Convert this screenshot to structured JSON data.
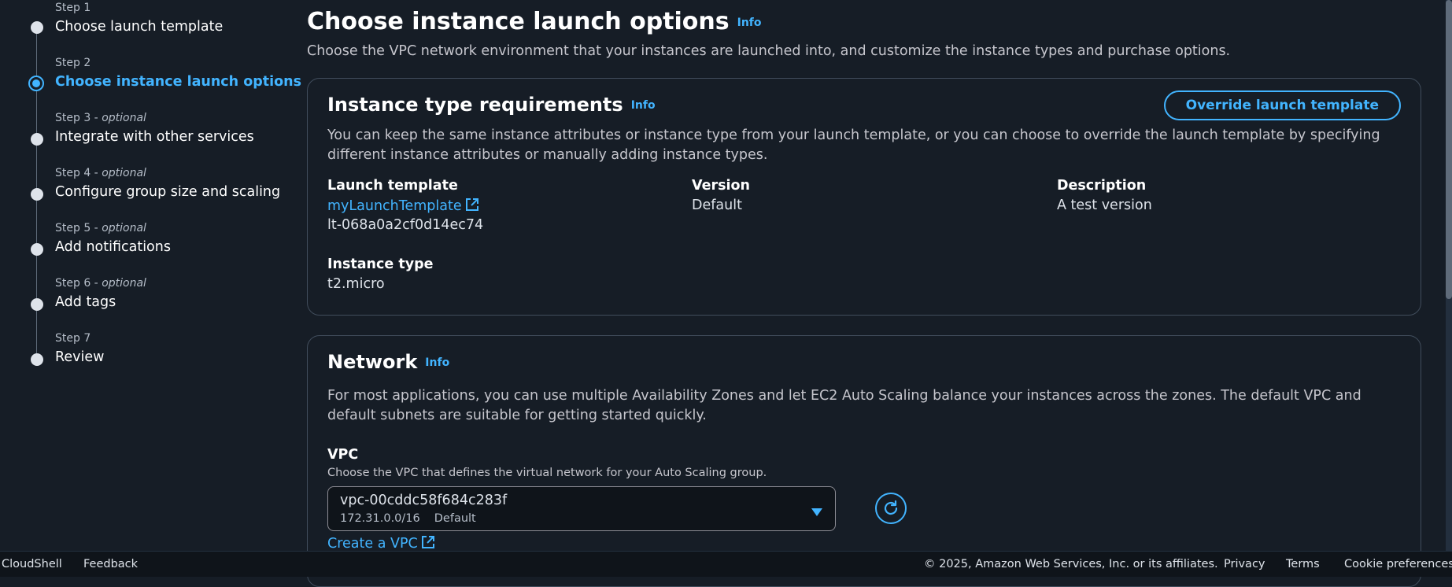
{
  "steps": [
    {
      "num": "Step 1",
      "optional": "",
      "title": "Choose launch template"
    },
    {
      "num": "Step 2",
      "optional": "",
      "title": "Choose instance launch options"
    },
    {
      "num": "Step 3 - ",
      "optional": "optional",
      "title": "Integrate with other services"
    },
    {
      "num": "Step 4 - ",
      "optional": "optional",
      "title": "Configure group size and scaling"
    },
    {
      "num": "Step 5 - ",
      "optional": "optional",
      "title": "Add notifications"
    },
    {
      "num": "Step 6 - ",
      "optional": "optional",
      "title": "Add tags"
    },
    {
      "num": "Step 7",
      "optional": "",
      "title": "Review"
    }
  ],
  "page": {
    "title": "Choose instance launch options",
    "info": "Info",
    "description": "Choose the VPC network environment that your instances are launched into, and customize the instance types and purchase options."
  },
  "instance_requirements": {
    "title": "Instance type requirements",
    "info": "Info",
    "override_button": "Override launch template",
    "description": "You can keep the same instance attributes or instance type from your launch template, or you can choose to override the launch template by specifying different instance attributes or manually adding instance types.",
    "launch_template_label": "Launch template",
    "launch_template_link": "myLaunchTemplate",
    "launch_template_id": "lt-068a0a2cf0d14ec74",
    "version_label": "Version",
    "version_value": "Default",
    "description_label": "Description",
    "description_value": "A test version",
    "instance_type_label": "Instance type",
    "instance_type_value": "t2.micro"
  },
  "network": {
    "title": "Network",
    "info": "Info",
    "description": "For most applications, you can use multiple Availability Zones and let EC2 Auto Scaling balance your instances across the zones. The default VPC and default subnets are suitable for getting started quickly.",
    "vpc_label": "VPC",
    "vpc_description": "Choose the VPC that defines the virtual network for your Auto Scaling group.",
    "vpc_selected": "vpc-00cddc58f684c283f",
    "vpc_cidr": "172.31.0.0/16",
    "vpc_tag": "Default",
    "create_vpc_link": "Create a VPC"
  },
  "footer": {
    "cloudshell": "CloudShell",
    "feedback": "Feedback",
    "copyright": "© 2025, Amazon Web Services, Inc. or its affiliates.",
    "privacy": "Privacy",
    "terms": "Terms",
    "cookie": "Cookie preferences"
  },
  "colors": {
    "accent": "#42b4ff",
    "background": "#161d26"
  }
}
